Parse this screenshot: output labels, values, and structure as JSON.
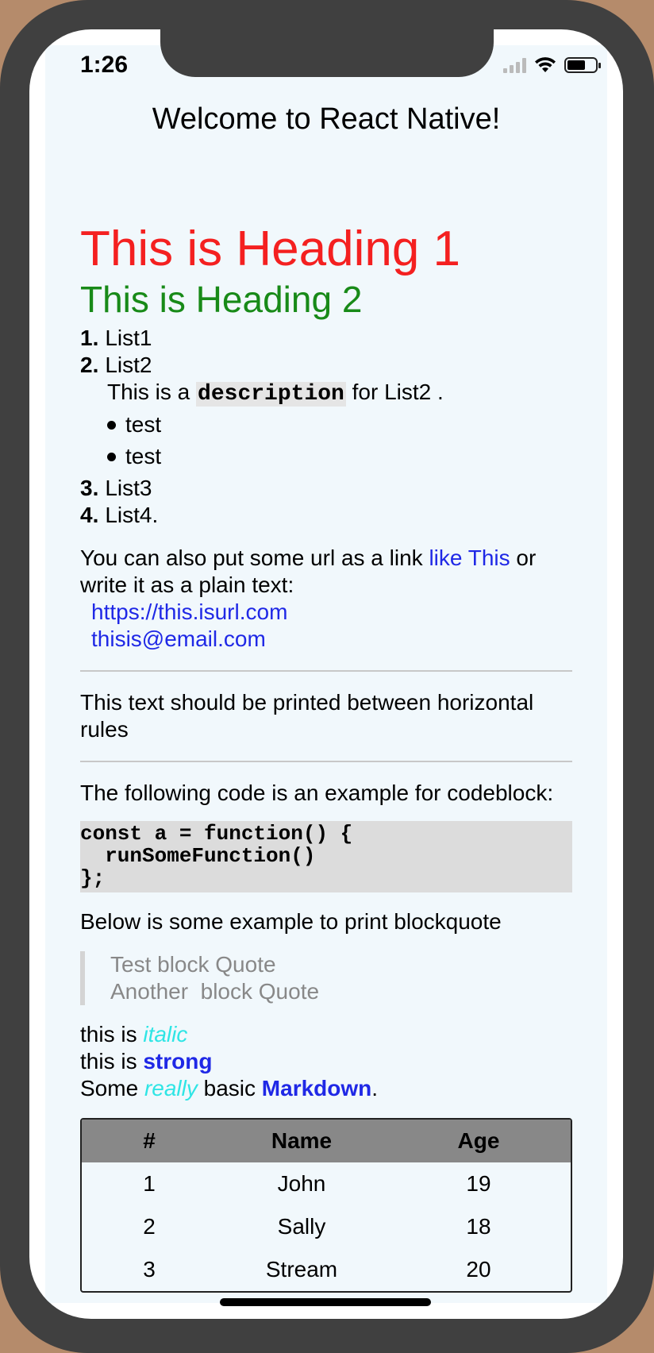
{
  "status_bar": {
    "time": "1:26"
  },
  "app": {
    "title": "Welcome to React Native!"
  },
  "markdown": {
    "heading1": "This is Heading 1",
    "heading2": "This is Heading 2",
    "ordered_list": [
      {
        "num": "1.",
        "text": "List1"
      },
      {
        "num": "2.",
        "text": "List2"
      },
      {
        "num": "3.",
        "text": "List3"
      },
      {
        "num": "4.",
        "text": "List4."
      }
    ],
    "list2_description": {
      "before": "This is a",
      "code": "description",
      "after": "for List2 ."
    },
    "bullets": [
      "test",
      "test"
    ],
    "link_paragraph": {
      "before": "You can also put some url as a link",
      "link_text": "like This",
      "after": "or write it as a plain text:",
      "url_text": "https://this.isurl.com",
      "email_text": "thisis@email.com"
    },
    "hr_text": "This text should be printed between horizontal rules",
    "code_intro": "The following code is an example for codeblock:",
    "codeblock": "const a = function() {\n  runSomeFunction()\n};",
    "blockquote_intro": "Below is some example to print blockquote",
    "blockquote_lines": [
      "Test block Quote",
      "Another  block Quote"
    ],
    "emphasis": {
      "line1_prefix": "this is",
      "line1_italic": "italic",
      "line2_prefix": "this is",
      "line2_strong": "strong",
      "line3_a": "Some",
      "line3_italic": "really",
      "line3_b": "basic",
      "line3_strong": "Markdown",
      "line3_end": "."
    },
    "table": {
      "headers": [
        "#",
        "Name",
        "Age"
      ],
      "rows": [
        [
          "1",
          "John",
          "19"
        ],
        [
          "2",
          "Sally",
          "18"
        ],
        [
          "3",
          "Stream",
          "20"
        ]
      ]
    }
  },
  "colors": {
    "heading1": "#f42020",
    "heading2": "#188a18",
    "link": "#1f28e6",
    "italic": "#2fe5e5",
    "table_header_bg": "#888888",
    "screen_bg": "#f1f8fc"
  }
}
